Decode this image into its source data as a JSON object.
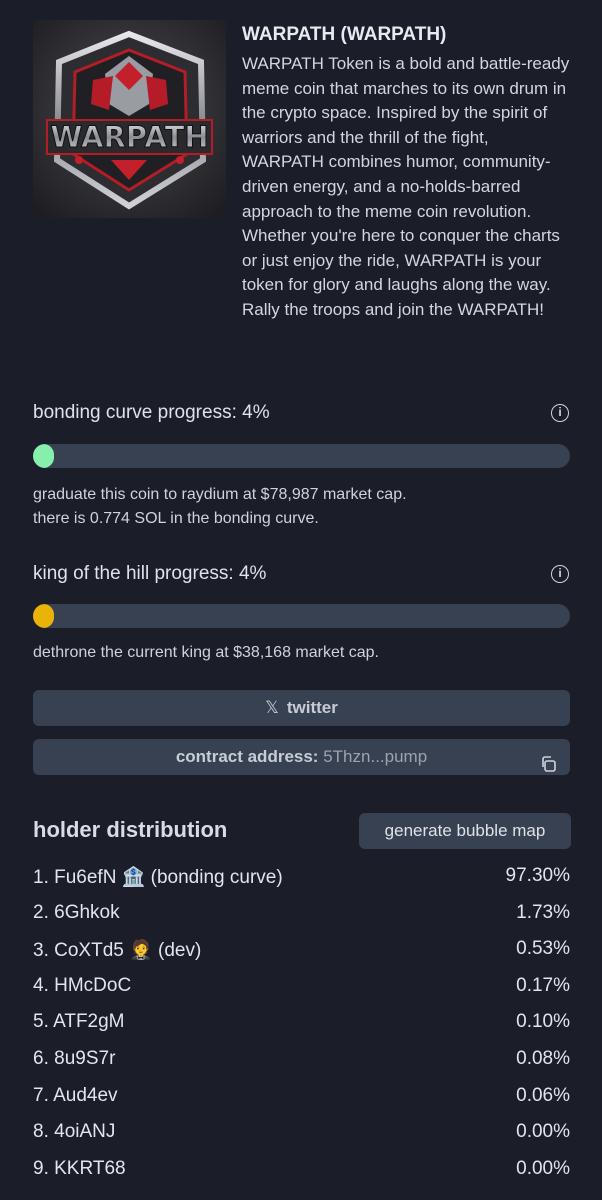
{
  "token": {
    "name": "WARPATH (WARPATH)",
    "logo_text": "WARPATH",
    "description": "WARPATH Token is a bold and battle-ready meme coin that marches to its own drum in the crypto space. Inspired by the spirit of warriors and the thrill of the fight, WARPATH combines humor, community-driven energy, and a no-holds-barred approach to the meme coin revolution. Whether you're here to conquer the charts or just enjoy the ride, WARPATH is your token for glory and laughs along the way. Rally the troops and join the WARPATH!"
  },
  "bonding": {
    "label": "bonding curve progress: 4%",
    "progress_percent": 4,
    "color": "#86efac",
    "note_line1": "graduate this coin to raydium at $78,987 market cap.",
    "note_line2": "there is 0.774 SOL in the bonding curve."
  },
  "koth": {
    "label": "king of the hill progress: 4%",
    "progress_percent": 4,
    "color": "#eab308",
    "note": "dethrone the current king at $38,168 market cap."
  },
  "twitter": {
    "icon": "x-logo-icon",
    "label": "twitter"
  },
  "contract": {
    "label": "contract address:",
    "value": "5Thzn...pump",
    "icon": "copy-icon"
  },
  "holders": {
    "title": "holder distribution",
    "bubble_button": "generate bubble map",
    "rows": [
      {
        "name": "1. Fu6efN",
        "emoji": "🏦",
        "tag": "(bonding curve)",
        "pct": "97.30%"
      },
      {
        "name": "2. 6Ghkok",
        "emoji": "",
        "tag": "",
        "pct": "1.73%"
      },
      {
        "name": "3. CoXTd5",
        "emoji": "🤵",
        "tag": "(dev)",
        "pct": "0.53%"
      },
      {
        "name": "4. HMcDoC",
        "emoji": "",
        "tag": "",
        "pct": "0.17%"
      },
      {
        "name": "5. ATF2gM",
        "emoji": "",
        "tag": "",
        "pct": "0.10%"
      },
      {
        "name": "6. 8u9S7r",
        "emoji": "",
        "tag": "",
        "pct": "0.08%"
      },
      {
        "name": "7. Aud4ev",
        "emoji": "",
        "tag": "",
        "pct": "0.06%"
      },
      {
        "name": "8. 4oiANJ",
        "emoji": "",
        "tag": "",
        "pct": "0.00%"
      },
      {
        "name": "9. KKRT68",
        "emoji": "",
        "tag": "",
        "pct": "0.00%"
      }
    ]
  }
}
